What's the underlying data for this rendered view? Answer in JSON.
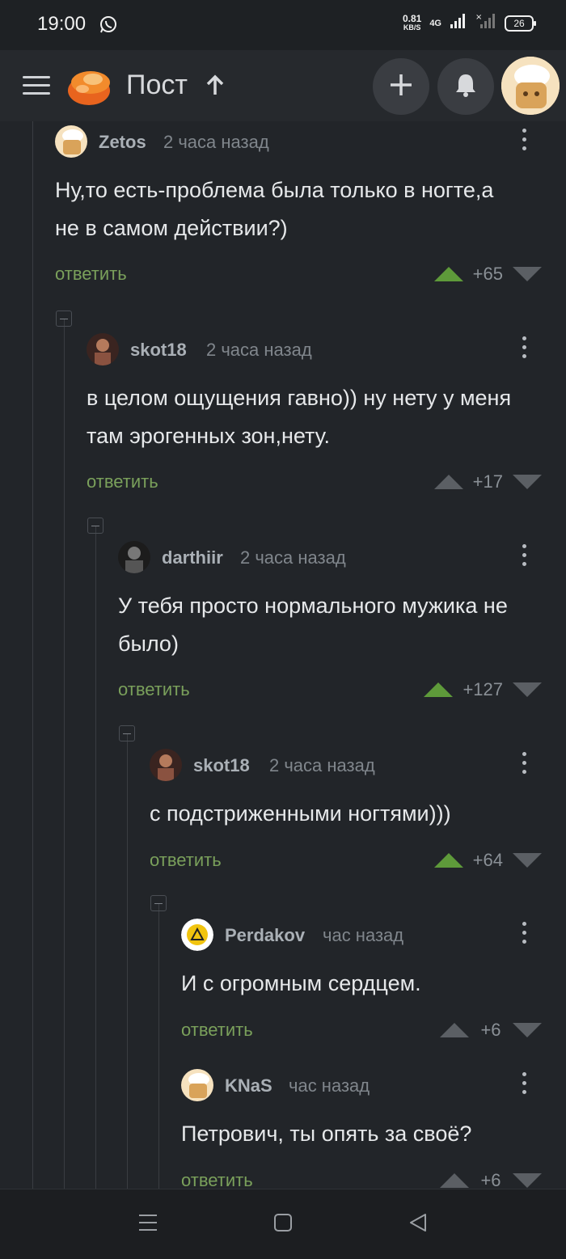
{
  "status_bar": {
    "time": "19:00",
    "net_speed": "0.81",
    "net_unit": "KB/S",
    "network": "4G",
    "battery": "26"
  },
  "header": {
    "title": "Пост",
    "icons": [
      "menu-icon",
      "pikabu-logo",
      "arrow-up-icon",
      "plus-icon",
      "bell-icon",
      "avatar"
    ]
  },
  "comments": [
    {
      "user": "Zetos",
      "time": "2 часа назад",
      "text": "Ну,то есть-проблема была только в ногте,а не в самом действии?)",
      "reply": "ответить",
      "score": "+65",
      "voted_up": true
    },
    {
      "user": "skot18",
      "time": "2 часа назад",
      "text": "в целом ощущения гавно)) ну нету у меня там эрогенных зон,нету.",
      "reply": "ответить",
      "score": "+17",
      "voted_up": false
    },
    {
      "user": "darthiir",
      "time": "2 часа назад",
      "text": "У тебя просто нормального мужика не было)",
      "reply": "ответить",
      "score": "+127",
      "voted_up": true
    },
    {
      "user": "skot18",
      "time": "2 часа назад",
      "text": "с подстриженными ногтями)))",
      "reply": "ответить",
      "score": "+64",
      "voted_up": true
    },
    {
      "user": "Perdakov",
      "time": "час назад",
      "text": "И с огромным сердцем.",
      "reply": "ответить",
      "score": "+6",
      "voted_up": false
    },
    {
      "user": "KNaS",
      "time": "час назад",
      "text": "Петрович, ты опять за своё?",
      "reply": "ответить",
      "score": "+6",
      "voted_up": false
    }
  ],
  "colors": {
    "accent_green": "#5e9a3a",
    "reply_green": "#7aa05b",
    "background": "#222529"
  }
}
